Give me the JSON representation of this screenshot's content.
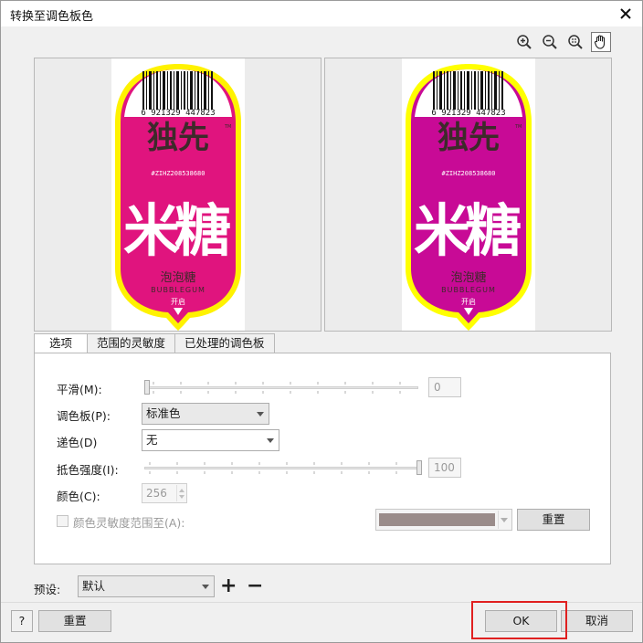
{
  "window": {
    "title": "转换至调色板色"
  },
  "toolbar": {
    "tools": [
      {
        "name": "zoom-in-icon"
      },
      {
        "name": "zoom-out-icon"
      },
      {
        "name": "zoom-fit-icon"
      },
      {
        "name": "hand-pan-icon",
        "active": true
      }
    ]
  },
  "preview": {
    "barcode_number": "6 921329 447823",
    "brand_top": "独先",
    "code_line": "#ZIHZ208538680",
    "big_char": "糖",
    "big_left": "米",
    "product_cn": "泡泡糖",
    "product_en": "BUBBLEGUM",
    "open_label": "开启",
    "tm": "TM",
    "colors": {
      "pink_left": "#e0147e",
      "pink_right": "#c80a96",
      "yellow": "#fff200",
      "dark": "#3d2a2a"
    }
  },
  "tabs": [
    {
      "label": "选项",
      "active": true
    },
    {
      "label": "范围的灵敏度",
      "active": false
    },
    {
      "label": "已处理的调色板",
      "active": false
    }
  ],
  "options": {
    "smoothing": {
      "label": "平滑(M):",
      "value": "0"
    },
    "palette": {
      "label": "调色板(P):",
      "value": "标准色"
    },
    "dither": {
      "label": "递色(D)",
      "value": "无"
    },
    "dither_strength": {
      "label": "抵色强度(I):",
      "value": "100"
    },
    "colors": {
      "label": "颜色(C):",
      "value": "256"
    },
    "sensitivity": {
      "label": "颜色灵敏度范围至(A):",
      "swatch_color": "#9a8c8a"
    },
    "reset_panel_label": "重置"
  },
  "footer": {
    "preset_label": "预设:",
    "preset_value": "默认",
    "plus": "+",
    "minus": "−",
    "help_label": "?",
    "reset_label": "重置",
    "ok_label": "OK",
    "cancel_label": "取消"
  }
}
